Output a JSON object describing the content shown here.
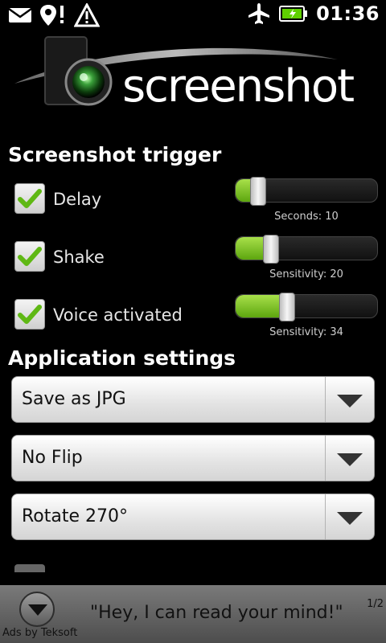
{
  "status_bar": {
    "time": "01:36",
    "left_icons": [
      "mail-icon",
      "location-alert-icon",
      "warning-icon"
    ],
    "right_icons": [
      "airplane-icon",
      "battery-icon"
    ],
    "battery_color": "#5fd000"
  },
  "header": {
    "logo_text": "screenshot"
  },
  "trigger_section": {
    "title": "Screenshot trigger",
    "items": [
      {
        "label": "Delay",
        "checked": true,
        "caption": "Seconds: 10",
        "level": 0.12
      },
      {
        "label": "Shake",
        "checked": true,
        "caption": "Sensitivity: 20",
        "level": 0.23
      },
      {
        "label": "Voice activated",
        "checked": true,
        "caption": "Sensitivity: 34",
        "level": 0.35
      }
    ]
  },
  "app_section": {
    "title": "Application settings",
    "spinners": [
      {
        "value": "Save as JPG"
      },
      {
        "value": "No Flip"
      },
      {
        "value": "Rotate 270°"
      }
    ]
  },
  "ad": {
    "text": "\"Hey, I can read your mind!\"",
    "credit": "Ads by Teksoft",
    "page": "1/2"
  },
  "colors": {
    "accent_green": "#7cc21f",
    "check_green": "#5fb814"
  }
}
